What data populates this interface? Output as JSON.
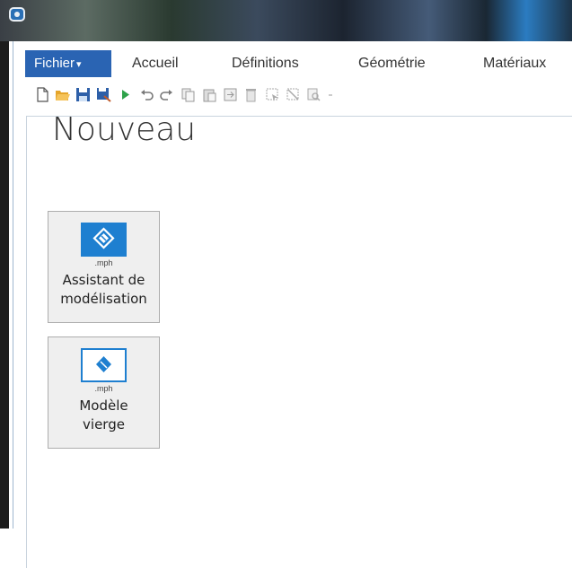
{
  "menu": {
    "file_label": "Fichier",
    "caret": "▾",
    "tabs": [
      "Accueil",
      "Définitions",
      "Géométrie",
      "Matériaux"
    ]
  },
  "toolbar": {
    "icons": [
      "new-file-icon",
      "open-folder-icon",
      "save-icon",
      "save-as-icon",
      "run-icon",
      "undo-icon",
      "redo-icon",
      "copy-icon",
      "paste-icon",
      "duplicate-icon",
      "delete-icon",
      "select-icon",
      "deselect-icon",
      "zoom-icon",
      "dropdown-icon"
    ]
  },
  "page": {
    "title": "Nouveau"
  },
  "cards": [
    {
      "ext": ".mph",
      "line1": "Assistant de",
      "line2": "modélisation",
      "icon": "wizard-icon"
    },
    {
      "ext": ".mph",
      "line1": "Modèle",
      "line2": "vierge",
      "icon": "blank-model-icon"
    }
  ],
  "colors": {
    "accent": "#2a64b3",
    "icon_blue": "#1e7fd0"
  }
}
